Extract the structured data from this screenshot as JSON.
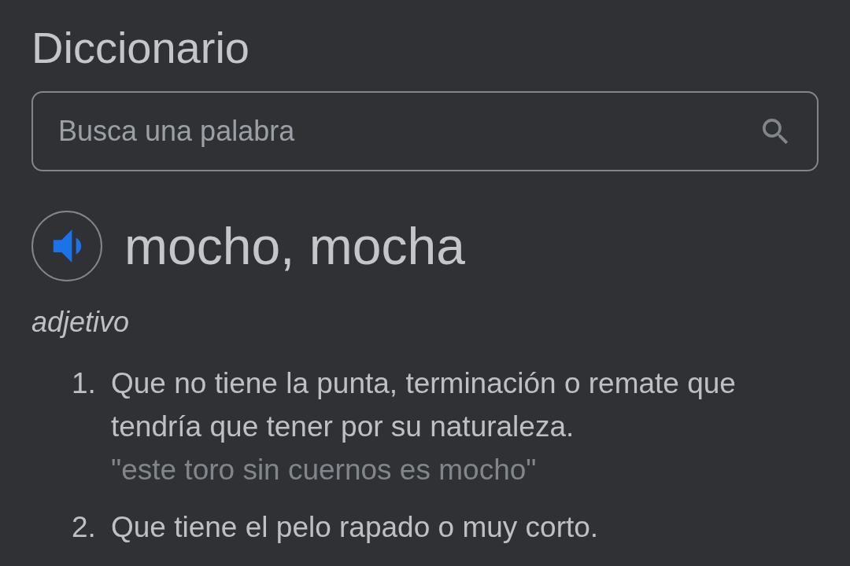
{
  "title": "Diccionario",
  "search": {
    "placeholder": "Busca una palabra"
  },
  "entry": {
    "headword": "mocho, mocha",
    "part_of_speech": "adjetivo",
    "definitions": [
      {
        "number": "1.",
        "text": "Que no tiene la punta, terminación o remate que tendría que tener por su naturaleza.",
        "example": "\"este toro sin cuernos es mocho\""
      },
      {
        "number": "2.",
        "text": "Que tiene el pelo rapado o muy corto."
      }
    ]
  }
}
